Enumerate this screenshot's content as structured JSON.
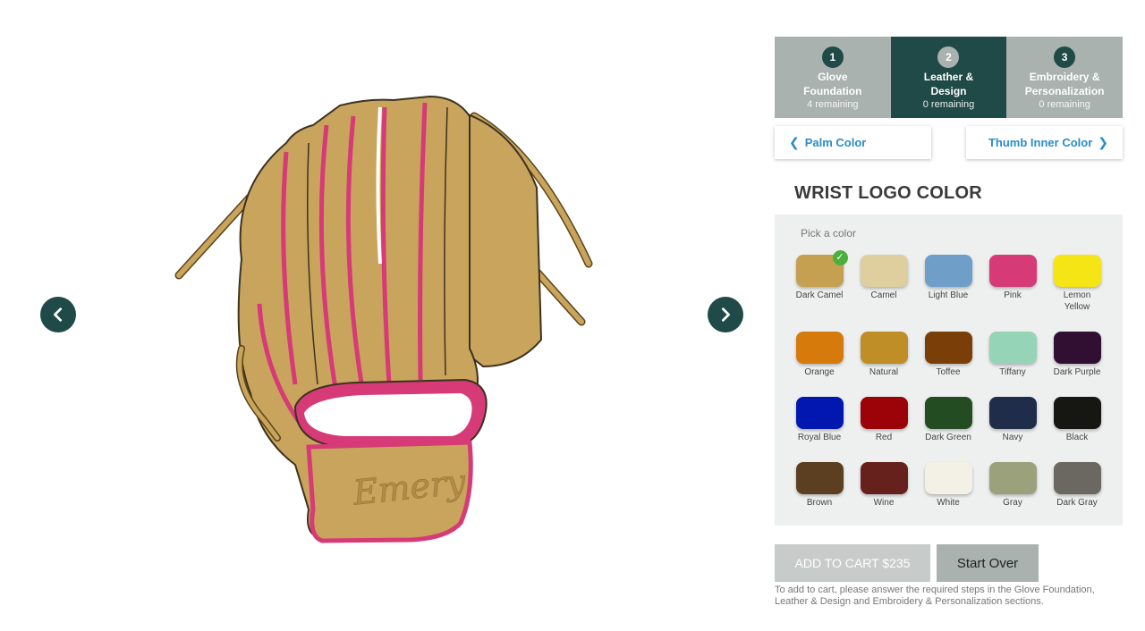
{
  "viewer": {
    "prev_label": "Previous view",
    "next_label": "Next view",
    "glove_text": "Emery"
  },
  "steps": [
    {
      "num": "1",
      "title_line1": "Glove",
      "title_line2": "Foundation",
      "remaining": "4 remaining",
      "active": false
    },
    {
      "num": "2",
      "title_line1": "Leather &",
      "title_line2": "Design",
      "remaining": "0 remaining",
      "active": true
    },
    {
      "num": "3",
      "title_line1": "Embroidery &",
      "title_line2": "Personalization",
      "remaining": "0 remaining",
      "active": false
    }
  ],
  "subnav": {
    "prev": "Palm Color",
    "next": "Thumb Inner Color"
  },
  "section": {
    "title": "WRIST LOGO COLOR",
    "pick_label": "Pick a color"
  },
  "colors": [
    {
      "name": "Dark Camel",
      "hex": "#c4a050",
      "selected": true
    },
    {
      "name": "Camel",
      "hex": "#dfcf9f",
      "selected": false
    },
    {
      "name": "Light Blue",
      "hex": "#6f9ec8",
      "selected": false
    },
    {
      "name": "Pink",
      "hex": "#d63a77",
      "selected": false
    },
    {
      "name": "Lemon Yellow",
      "hex": "#f6e514",
      "selected": false
    },
    {
      "name": "Orange",
      "hex": "#d77a0c",
      "selected": false
    },
    {
      "name": "Natural",
      "hex": "#bf8e26",
      "selected": false
    },
    {
      "name": "Toffee",
      "hex": "#7a3f08",
      "selected": false
    },
    {
      "name": "Tiffany",
      "hex": "#96d4b8",
      "selected": false
    },
    {
      "name": "Dark Purple",
      "hex": "#300f33",
      "selected": false
    },
    {
      "name": "Royal Blue",
      "hex": "#0217b0",
      "selected": false
    },
    {
      "name": "Red",
      "hex": "#9c0308",
      "selected": false
    },
    {
      "name": "Dark Green",
      "hex": "#234c22",
      "selected": false
    },
    {
      "name": "Navy",
      "hex": "#1f2d4a",
      "selected": false
    },
    {
      "name": "Black",
      "hex": "#161713",
      "selected": false
    },
    {
      "name": "Brown",
      "hex": "#5c3f21",
      "selected": false
    },
    {
      "name": "Wine",
      "hex": "#67211d",
      "selected": false
    },
    {
      "name": "White",
      "hex": "#f3f1e6",
      "selected": false
    },
    {
      "name": "Gray",
      "hex": "#9ba17b",
      "selected": false
    },
    {
      "name": "Dark Gray",
      "hex": "#6b6761",
      "selected": false
    }
  ],
  "actions": {
    "add_to_cart": "ADD TO CART $235",
    "start_over": "Start Over",
    "note": "To add to cart, please answer the required steps in the Glove Foundation, Leather & Design and Embroidery & Personalization sections."
  },
  "theme": {
    "accent_dark": "#1f4a47",
    "step_inactive": "#a9b2af",
    "link_blue": "#2a8cc7",
    "glove_leather": "#c9a45c",
    "glove_binding": "#d63a77"
  }
}
